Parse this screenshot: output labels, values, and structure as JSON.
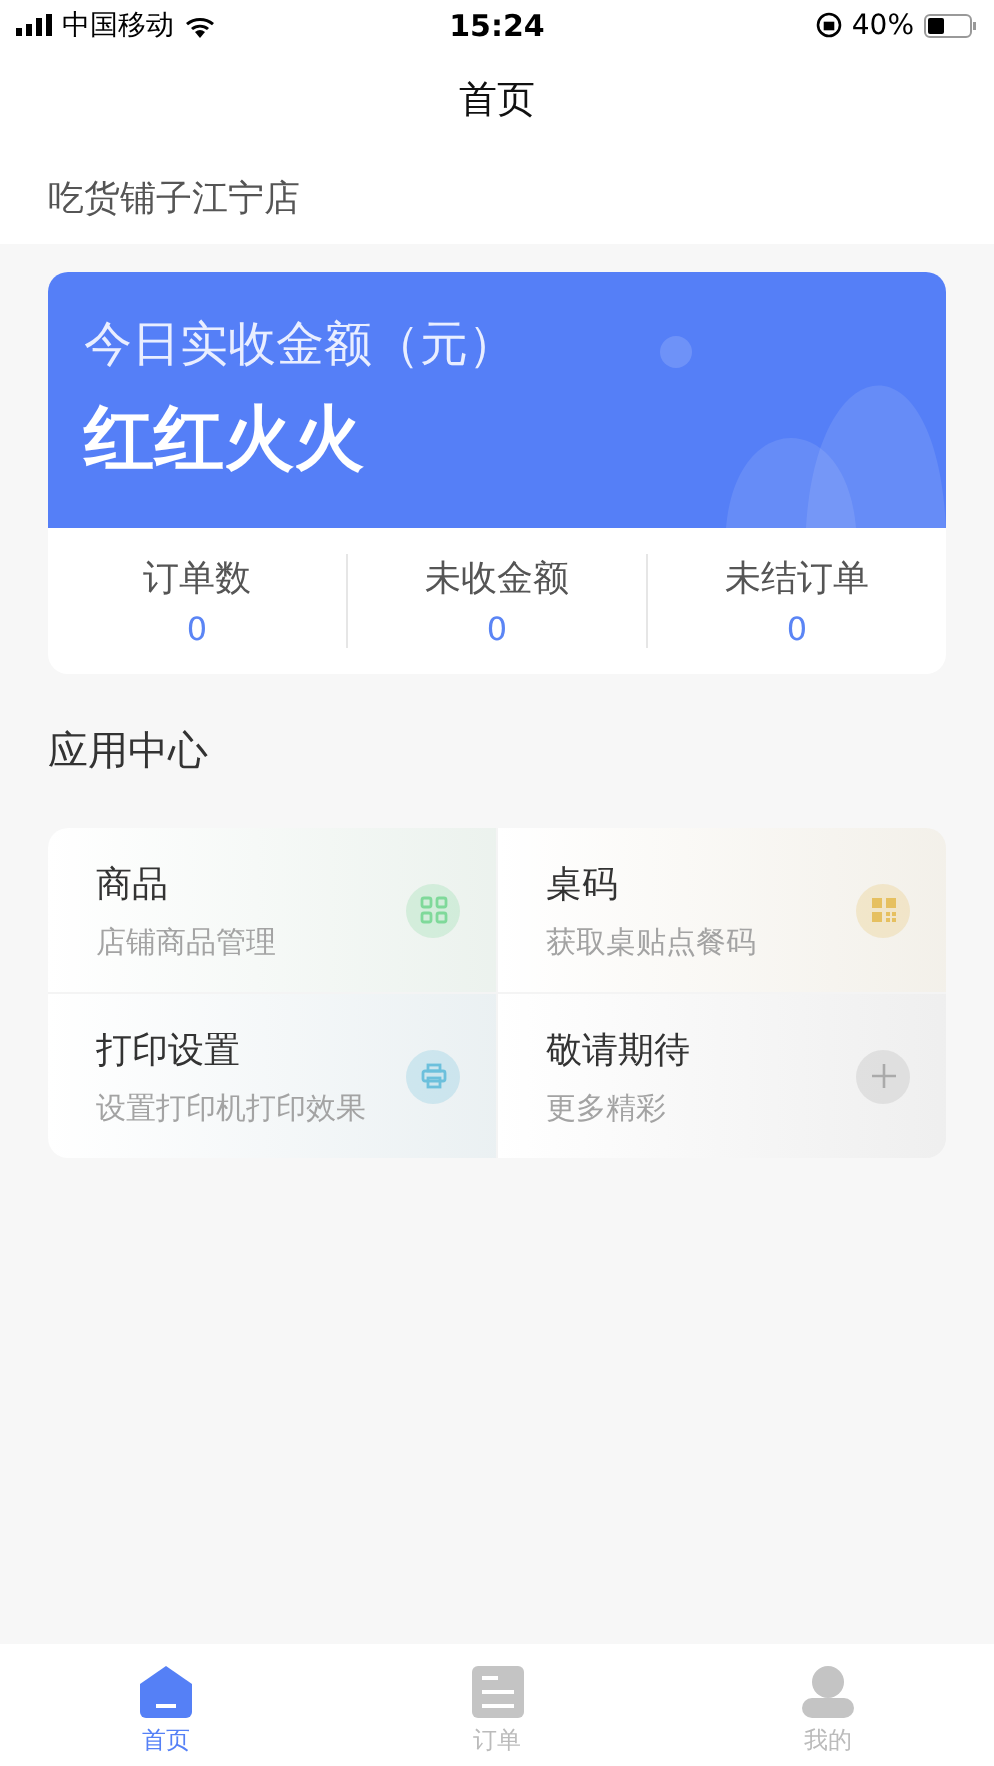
{
  "status_bar": {
    "carrier": "中国移动",
    "time": "15:24",
    "battery": "40%"
  },
  "nav": {
    "title": "首页"
  },
  "store": {
    "name": "吃货铺子江宁店"
  },
  "revenue": {
    "label": "今日实收金额（元）",
    "value": "红红火火"
  },
  "stats": [
    {
      "label": "订单数",
      "value": "0"
    },
    {
      "label": "未收金额",
      "value": "0"
    },
    {
      "label": "未结订单",
      "value": "0"
    }
  ],
  "apps_title": "应用中心",
  "apps": [
    {
      "title": "商品",
      "subtitle": "店铺商品管理",
      "kind": "grid",
      "color": "#7fd99a"
    },
    {
      "title": "桌码",
      "subtitle": "获取桌贴点餐码",
      "kind": "qrcode",
      "color": "#e6c060"
    },
    {
      "title": "打印设置",
      "subtitle": "设置打印机打印效果",
      "kind": "printer",
      "color": "#6cc0dc"
    },
    {
      "title": "敬请期待",
      "subtitle": "更多精彩",
      "kind": "plus",
      "color": "#aaaaaa"
    }
  ],
  "tabs": [
    {
      "label": "首页",
      "kind": "home",
      "selected": true
    },
    {
      "label": "订单",
      "kind": "list",
      "selected": false
    },
    {
      "label": "我的",
      "kind": "user",
      "selected": false
    }
  ]
}
